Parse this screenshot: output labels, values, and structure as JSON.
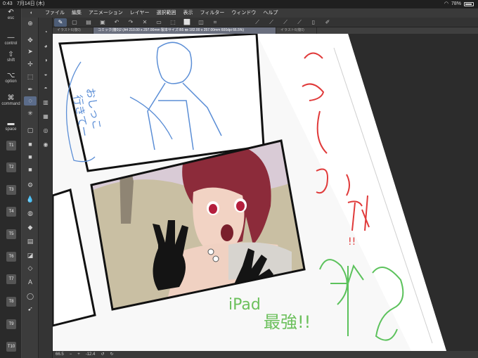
{
  "status": {
    "time": "0:43",
    "date": "7月14日 (木)",
    "wifi_icon": "wifi-icon",
    "battery": "78%"
  },
  "keys": {
    "esc": "esc",
    "control": "control",
    "shift": "shift",
    "option": "option",
    "command": "command",
    "space": "space",
    "tkeys": [
      "T1",
      "T2",
      "T3",
      "T4",
      "T5",
      "T6",
      "T7",
      "T8",
      "T9",
      "T10"
    ]
  },
  "menu": {
    "items": [
      "ファイル",
      "編集",
      "アニメーション",
      "レイヤー",
      "選択範囲",
      "表示",
      "フィルター",
      "ウィンドウ",
      "ヘルプ"
    ]
  },
  "tabs": [
    "イラスト6(複0)",
    "コミック(複0)2 (A4 210.00 x 297.00mm 製本サイズ:B5 ㎜ 182.00 x 257.00mm 600dpi 66.5%)",
    "イラスト6(複0)"
  ],
  "canvas": {
    "sketch_text_1": "おしっこ",
    "sketch_text_2": "行きてー",
    "red_text_1": "こうじゃに",
    "red_text_2": "!!",
    "green_text_1": "iPad",
    "green_text_2": "最強!!"
  },
  "bottom": {
    "zoom": "66.5",
    "angle": "-12.4"
  },
  "colors": {
    "main": "#3a2230",
    "sub": "#ffffff",
    "accent": "#5b6c8a"
  }
}
